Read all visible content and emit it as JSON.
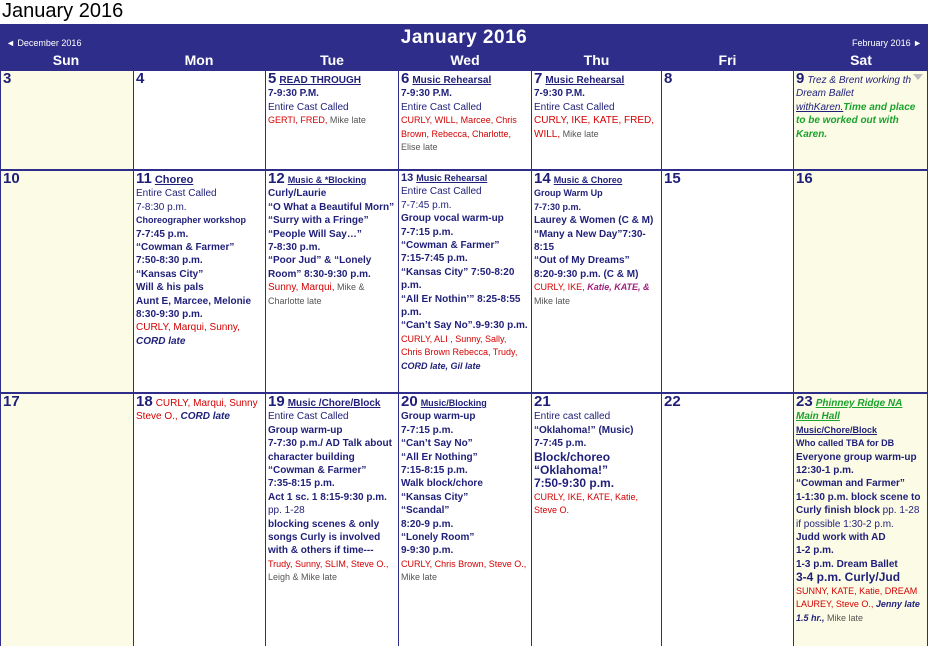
{
  "page_title": "January 2016",
  "nav": {
    "prev": "◄ December 2016",
    "next": "February 2016 ►",
    "month": "January  2016"
  },
  "days_of_week": [
    "Sun",
    "Mon",
    "Tue",
    "Wed",
    "Thu",
    "Fri",
    "Sat"
  ],
  "cells": {
    "d3": {
      "num": "3"
    },
    "d4": {
      "num": "4"
    },
    "d5": {
      "num": "5",
      "title": "READ THROUGH",
      "l1": "7-9:30 P.M.",
      "l2": "Entire Cast Called",
      "l3": "GERTI, FRED,",
      "l4": " Mike late"
    },
    "d6": {
      "num": "6",
      "title": "Music  Rehearsal",
      "l1": "7-9:30  P.M.",
      "l2": "Entire Cast Called",
      "l3": "CURLY, WILL, Marcee, Chris Brown, Rebecca, Charlotte,",
      "l4": " Elise  late"
    },
    "d7": {
      "num": "7",
      "title": "Music  Rehearsal",
      "l1": "7-9:30  P.M.",
      "l2": "Entire Cast Called",
      "l3": "CURLY,  IKE,  KATE, FRED, WILL,",
      "l4": " Mike late"
    },
    "d8": {
      "num": "8"
    },
    "d9": {
      "num": "9",
      "l1": "Trez & Brent working th",
      "l2": "Dream Ballet",
      "l3": "withKaren.",
      "l4": "Time and place to be worked out with Karen."
    },
    "d10": {
      "num": "10"
    },
    "d11": {
      "num": "11",
      "title": "Choreo",
      "l1": "Entire Cast Called",
      "l2": "7-8:30 p.m.",
      "l3": "Choreographer workshop",
      "l4": "7-7:45  p.m.",
      "l5": "“Cowman  &  Farmer”",
      "l6": "7:50-8:30 p.m.",
      "l7": "“Kansas  City”",
      "l8": "Will  &  his  pals",
      "l9": "Aunt  E,  Marcee,  Melonie",
      "l10": "8:30-9:30 p.m.",
      "l11": "CURLY, Marqui, Sunny,",
      "l12": "CORD late"
    },
    "d12": {
      "num": "12",
      "title": "Music  &  *Blocking",
      "l1": "Curly/Laurie",
      "l2": "“O  What  a  Beautiful Morn”",
      "l3": "“Surry  with  a  Fringe”",
      "l4": "“People  Will  Say…”",
      "l5": "7-8:30  p.m.",
      "l6": "“Poor  Jud”  &  “Lonely Room”  8:30-9:30 p.m.",
      "l7": " Sunny, Marqui,",
      "l8": " Mike & Charlotte late"
    },
    "d13": {
      "num": "13",
      "title": "Music  Rehearsal",
      "l1": "Entire Cast Called",
      "l2": "7-7:45 p.m.",
      "l3": "Group  vocal  warm-up",
      "l4": "7-7:15  p.m.",
      "l5": "“Cowman  &  Farmer”",
      "l6": "7:15-7:45  p.m.",
      "l7": "“Kansas  City”  7:50-8:20 p.m.",
      "l8": "“All  Er  Nothin’”  8:25-8:55 p.m.",
      "l9": "“Can’t  Say  No”.9-9:30 p.m.",
      "l10": " CURLY, ALI , Sunny, Sally, Chris Brown Rebecca, Trudy,",
      "l11": "CORD late, Gil late"
    },
    "d14": {
      "num": "14",
      "title": "Music  &  Choreo",
      "l1": "Group  Warm  Up",
      "l2": "7-7:30  p.m.",
      "l3": "Laurey  &  Women  (C  & M)",
      "l4": "“Many  a  New Day”7:30-8:15",
      "l5": "“Out  of  My  Dreams”",
      "l6": "8:20-9:30  p.m.  (C  &  M)",
      "l7": "CURLY, IKE,",
      "l8": "Katie, KATE, &",
      "l9": " Mike late"
    },
    "d15": {
      "num": "15"
    },
    "d16": {
      "num": "16"
    },
    "d17": {
      "num": "17"
    },
    "d18": {
      "num": "18",
      "l1": "CURLY, Marqui, Sunny Steve O.,",
      "l2": "CORD late"
    },
    "d19": {
      "num": "19",
      "title": "Music /Chore/Block",
      "l1": "Entire Cast Called",
      "l2": "Group  warm-up",
      "l3": "7-7:30  p.m./ AD  Talk about  character  building",
      "l4": " “Cowman  &  Farmer”",
      "l5": "7:35-8:15  p.m.",
      "l6": "Act  1  sc.  1  8:15-9:30 p.m.",
      "l7": "pp.  1-28",
      "l8": "blocking  scenes  &  only songs  Curly  is  involved with  &  others  if  time---",
      "l9": "Trudy, Sunny, SLIM, Steve O.,",
      "l10": "Leigh & Mike late"
    },
    "d20": {
      "num": "20",
      "title": "Music/Blocking",
      "l1": "Group  warm-up",
      "l2": "7-7:15  p.m.",
      "l3": "“Can’t  Say  No”",
      "l4": "“All  Er  Nothing”",
      "l5": "7:15-8:15  p.m.",
      "l6": "Walk  block/chore",
      "l7": "“Kansas  City”",
      "l8": "“Scandal”",
      "l9": "8:20-9  p.m.",
      "l10": "“Lonely  Room”",
      "l11": "9-9:30  p.m.",
      "l12": "CURLY, Chris Brown, Steve O.,",
      "l13": " Mike late"
    },
    "d21": {
      "num": "21",
      "l1": "Entire cast called",
      "l2": "“Oklahoma!”  (Music)",
      "l3": "7-7:45  p.m.",
      "l4": "Block/choreo",
      "l5": "“Oklahoma!”",
      "l6": "7:50-9:30 p.m.",
      "l7": " CURLY, IKE, KATE, Katie, Steve O."
    },
    "d22": {
      "num": "22"
    },
    "d23": {
      "num": "23",
      "title": "Phinney Ridge NA Main Hall",
      "sub": "Music/Chore/Block",
      "l1": "Who  called  TBA  for  DB",
      "l2": "Everyone  group  warm-up",
      "l3": "12:30-1  p.m.",
      "l4": "“Cowman  and  Farmer”",
      "l5": "1-1:30  p.m.  block  scene to",
      "l6": "Curly  finish  block",
      "l6b": " pp. 1-28 if possible 1:30-2 p.m.",
      "l7": "Judd  work  with  AD",
      "l8": "1-2  p.m.",
      "l9": "1-3  p.m.  Dream  Ballet",
      "l10": "3-4 p.m.  Curly/Jud",
      "l11": "SUNNY, KATE, Katie, DREAM LAUREY, Steve O.,",
      "l12": "Jenny late",
      "l13": "1.5 hr.,",
      "l14": " Mike late"
    }
  }
}
